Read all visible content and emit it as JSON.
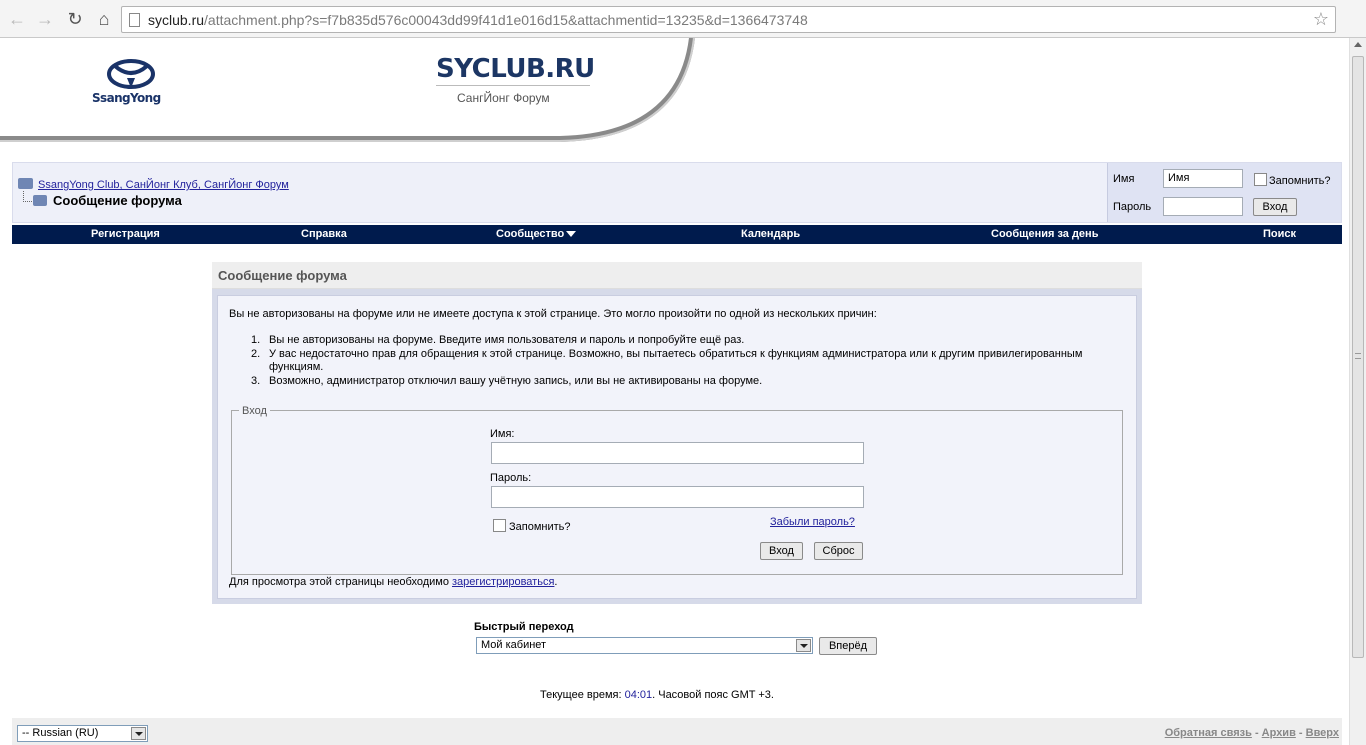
{
  "browser": {
    "url_host": "syclub.ru",
    "url_path": "/attachment.php?s=f7b835d576c00043dd99f41d1e016d15&attachmentid=13235&d=1366473748"
  },
  "header": {
    "brand_logo_text": "SsangYong",
    "site_name": "SYCLUB.RU",
    "site_subtitle": "СангЙонг Форум"
  },
  "breadcrumb": {
    "root_link": "SsangYong Club, СанЙонг Клуб, СангЙонг Форум",
    "current": "Сообщение форума"
  },
  "login": {
    "username_label": "Имя",
    "username_value": "Имя",
    "password_label": "Пароль",
    "remember_label": "Запомнить?",
    "submit_label": "Вход"
  },
  "navbar": {
    "items": [
      "Регистрация",
      "Справка",
      "Сообщество",
      "Календарь",
      "Сообщения за день",
      "Поиск"
    ]
  },
  "message": {
    "title": "Сообщение форума",
    "intro": "Вы не авторизованы на форуме или не имеете доступа к этой странице. Это могло произойти по одной из нескольких причин:",
    "reasons": [
      {
        "num": "1.",
        "text": "Вы не авторизованы на форуме. Введите имя пользователя и пароль и попробуйте ещё раз."
      },
      {
        "num": "2.",
        "text": "У вас недостаточно прав для обращения к этой странице. Возможно, вы пытаетесь обратиться к функциям администратора или к другим привилегированным функциям."
      },
      {
        "num": "3.",
        "text": "Возможно, администратор отключил вашу учётную запись, или вы не активированы на форуме."
      }
    ],
    "form": {
      "legend": "Вход",
      "username_label": "Имя:",
      "password_label": "Пароль:",
      "remember_label": "Запомнить?",
      "forgot_link": "Забыли пароль?",
      "submit_label": "Вход",
      "reset_label": "Сброс"
    },
    "footer_text": "Для просмотра этой страницы необходимо ",
    "footer_link": "зарегистрироваться",
    "footer_end": "."
  },
  "quick_nav": {
    "label": "Быстрый переход",
    "selected": "Мой кабинет",
    "go_label": "Вперёд"
  },
  "time": {
    "prefix": "Текущее время: ",
    "value": "04:01",
    "suffix": ". Часовой пояс GMT +3."
  },
  "footer": {
    "language": "-- Russian (RU)",
    "links": [
      "Обратная связь",
      "Архив",
      "Вверх"
    ],
    "separator": " - "
  },
  "colors": {
    "navbar": "#001b4d",
    "link": "#22229c",
    "brand": "#1c3664"
  }
}
